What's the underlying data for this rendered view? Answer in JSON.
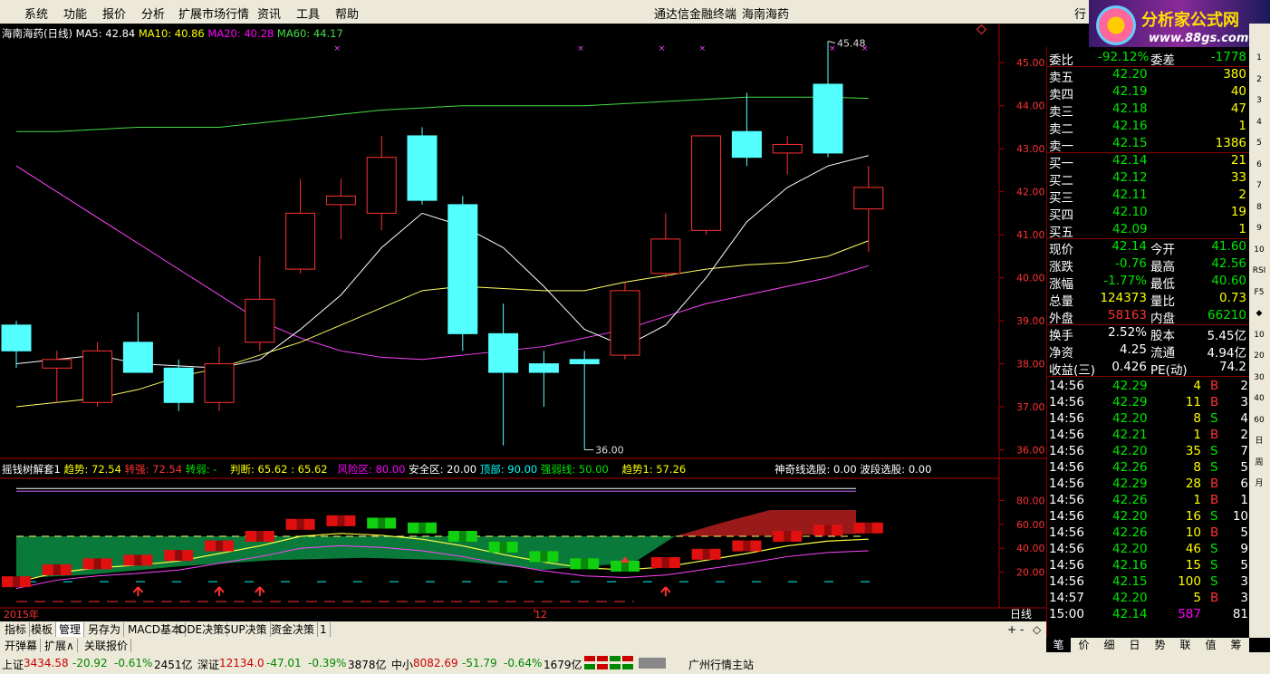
{
  "menubar": {
    "items": [
      "系统",
      "功能",
      "报价",
      "分析",
      "扩展市场行情",
      "资讯",
      "工具",
      "帮助"
    ],
    "app_title": "通达信金融终端",
    "stock_title": "海南海药",
    "right_button": "行"
  },
  "logo": {
    "line1": "分析家公式网",
    "line2": "www.88gs.com"
  },
  "main_legend": {
    "name": "海南海药(日线)",
    "ma5": "MA5: 42.84",
    "ma10": "MA10: 40.86",
    "ma20": "MA20: 40.28",
    "ma60": "MA60: 44.17"
  },
  "price_axis": [
    "45.00",
    "44.00",
    "43.00",
    "42.00",
    "41.00",
    "40.00",
    "39.00",
    "38.00",
    "37.00",
    "36.00"
  ],
  "annotations": {
    "high": "45.48",
    "low": "36.00"
  },
  "indicator_legend": {
    "name": "摇钱树解套1",
    "trend": "趋势: 72.54",
    "strong": "转强: 72.54",
    "weak": "转弱: -",
    "judge": "判断: 65.62 : 65.62",
    "risk": "风险区: 80.00",
    "safe": "安全区: 20.00",
    "top": "顶部: 90.00",
    "line": "强弱线: 50.00",
    "trend1": "趋势1: 57.26",
    "magic": "神奇线选股: 0.00",
    "wave": "波段选股: 0.00"
  },
  "indicator_axis": [
    "80.00",
    "60.00",
    "40.00",
    "20.00"
  ],
  "date_axis": {
    "left": "2015年",
    "mid": "12",
    "period": "日线",
    "ctrl": [
      "+",
      "-",
      "◇"
    ]
  },
  "quote": {
    "wei": {
      "label1": "委比",
      "v1": "-92.12%",
      "label2": "委差",
      "v2": "-1778"
    },
    "sells": [
      {
        "label": "卖五",
        "price": "42.20",
        "vol": "380"
      },
      {
        "label": "卖四",
        "price": "42.19",
        "vol": "40"
      },
      {
        "label": "卖三",
        "price": "42.18",
        "vol": "47"
      },
      {
        "label": "卖二",
        "price": "42.16",
        "vol": "1"
      },
      {
        "label": "卖一",
        "price": "42.15",
        "vol": "1386"
      }
    ],
    "buys": [
      {
        "label": "买一",
        "price": "42.14",
        "vol": "21"
      },
      {
        "label": "买二",
        "price": "42.12",
        "vol": "33"
      },
      {
        "label": "买三",
        "price": "42.11",
        "vol": "2"
      },
      {
        "label": "买四",
        "price": "42.10",
        "vol": "19"
      },
      {
        "label": "买五",
        "price": "42.09",
        "vol": "1"
      }
    ],
    "stats": [
      {
        "l1": "现价",
        "v1": "42.14",
        "c1": "dn",
        "l2": "今开",
        "v2": "41.60",
        "c2": "dn"
      },
      {
        "l1": "涨跌",
        "v1": "-0.76",
        "c1": "dn",
        "l2": "最高",
        "v2": "42.56",
        "c2": "dn"
      },
      {
        "l1": "涨幅",
        "v1": "-1.77%",
        "c1": "dn",
        "l2": "最低",
        "v2": "40.60",
        "c2": "dn"
      },
      {
        "l1": "总量",
        "v1": "124373",
        "c1": "yl",
        "l2": "量比",
        "v2": "0.73",
        "c2": "yl"
      },
      {
        "l1": "外盘",
        "v1": "58163",
        "c1": "up",
        "l2": "内盘",
        "v2": "66210",
        "c2": "dn"
      }
    ],
    "fund": [
      {
        "l1": "换手",
        "v1": "2.52%",
        "l2": "股本",
        "v2": "5.45亿"
      },
      {
        "l1": "净资",
        "v1": "4.25",
        "l2": "流通",
        "v2": "4.94亿"
      },
      {
        "l1": "收益(三)",
        "v1": "0.426",
        "l2": "PE(动)",
        "v2": "74.2"
      }
    ],
    "ticks": [
      {
        "t": "14:56",
        "p": "42.29",
        "v": "4",
        "bs": "B",
        "n": "2"
      },
      {
        "t": "14:56",
        "p": "42.29",
        "v": "11",
        "bs": "B",
        "n": "3"
      },
      {
        "t": "14:56",
        "p": "42.20",
        "v": "8",
        "bs": "S",
        "n": "4"
      },
      {
        "t": "14:56",
        "p": "42.21",
        "v": "1",
        "bs": "B",
        "n": "2"
      },
      {
        "t": "14:56",
        "p": "42.20",
        "v": "35",
        "bs": "S",
        "n": "7"
      },
      {
        "t": "14:56",
        "p": "42.26",
        "v": "8",
        "bs": "S",
        "n": "5"
      },
      {
        "t": "14:56",
        "p": "42.29",
        "v": "28",
        "bs": "B",
        "n": "6"
      },
      {
        "t": "14:56",
        "p": "42.26",
        "v": "1",
        "bs": "B",
        "n": "1"
      },
      {
        "t": "14:56",
        "p": "42.20",
        "v": "16",
        "bs": "S",
        "n": "10"
      },
      {
        "t": "14:56",
        "p": "42.26",
        "v": "10",
        "bs": "B",
        "n": "5"
      },
      {
        "t": "14:56",
        "p": "42.20",
        "v": "46",
        "bs": "S",
        "n": "9"
      },
      {
        "t": "14:56",
        "p": "42.16",
        "v": "15",
        "bs": "S",
        "n": "5"
      },
      {
        "t": "14:56",
        "p": "42.15",
        "v": "100",
        "bs": "S",
        "n": "3"
      },
      {
        "t": "14:57",
        "p": "42.20",
        "v": "5",
        "bs": "B",
        "n": "3"
      },
      {
        "t": "15:00",
        "p": "42.14",
        "v": "587",
        "bs": "",
        "n": "81"
      }
    ]
  },
  "tabs1": [
    "指标",
    "模板",
    "管理",
    "另存为",
    "MACD基本",
    "DDE决策",
    "SUP决策",
    "资金决策",
    "1"
  ],
  "tabs2": [
    "开弹幕",
    "扩展∧",
    "关联报价"
  ],
  "rtabs": [
    "笔",
    "价",
    "细",
    "日",
    "势",
    "联",
    "值",
    "筹"
  ],
  "toolstrip": [
    "1",
    "2",
    "3",
    "4",
    "5",
    "6",
    "7",
    "8",
    "9",
    "10",
    "RSI",
    "F5",
    "◆",
    "10",
    "20",
    "30",
    "40",
    "60",
    "日",
    "周",
    "月"
  ],
  "statusbar": {
    "sh": {
      "label": "上证",
      "idx": "3434.58",
      "chg": "-20.92",
      "pct": "-0.61%",
      "amt": "2451亿"
    },
    "sz": {
      "label": "深证",
      "idx": "12134.0",
      "chg": "-47.01",
      "pct": "-0.39%",
      "amt": "3878亿"
    },
    "zx": {
      "label": "中小",
      "idx": "8082.69",
      "chg": "-51.79",
      "pct": "-0.64%",
      "amt": "1679亿"
    },
    "station": "广州行情主站"
  },
  "colors": {
    "up": "#ff3232",
    "down": "#54ffff",
    "ma5": "#ffffff",
    "ma10": "#ffff66",
    "ma20": "#ff44ff",
    "ma60": "#44dd44"
  },
  "chart_data": {
    "type": "candlestick",
    "ylim": [
      35.8,
      45.7
    ],
    "candles": [
      {
        "o": 38.9,
        "h": 39.0,
        "l": 37.9,
        "c": 38.3
      },
      {
        "o": 37.9,
        "h": 38.3,
        "l": 37.1,
        "c": 38.1
      },
      {
        "o": 37.1,
        "h": 38.5,
        "l": 37.0,
        "c": 38.3
      },
      {
        "o": 38.5,
        "h": 39.2,
        "l": 37.8,
        "c": 37.8
      },
      {
        "o": 37.9,
        "h": 38.1,
        "l": 36.9,
        "c": 37.1
      },
      {
        "o": 37.1,
        "h": 38.4,
        "l": 36.9,
        "c": 38.0
      },
      {
        "o": 38.5,
        "h": 40.5,
        "l": 38.3,
        "c": 39.5
      },
      {
        "o": 40.2,
        "h": 42.3,
        "l": 40.1,
        "c": 41.5
      },
      {
        "o": 41.7,
        "h": 42.3,
        "l": 40.9,
        "c": 41.9
      },
      {
        "o": 41.5,
        "h": 43.3,
        "l": 41.1,
        "c": 42.8
      },
      {
        "o": 43.3,
        "h": 43.5,
        "l": 41.7,
        "c": 41.8
      },
      {
        "o": 41.7,
        "h": 41.9,
        "l": 38.3,
        "c": 38.7
      },
      {
        "o": 38.7,
        "h": 39.4,
        "l": 36.1,
        "c": 37.8
      },
      {
        "o": 38.0,
        "h": 38.3,
        "l": 37.0,
        "c": 37.8
      },
      {
        "o": 38.1,
        "h": 38.3,
        "l": 36.0,
        "c": 38.0
      },
      {
        "o": 38.2,
        "h": 39.9,
        "l": 38.1,
        "c": 39.7
      },
      {
        "o": 40.1,
        "h": 41.5,
        "l": 40.0,
        "c": 40.9
      },
      {
        "o": 41.1,
        "h": 43.3,
        "l": 41.0,
        "c": 43.3
      },
      {
        "o": 43.4,
        "h": 44.3,
        "l": 42.6,
        "c": 42.8
      },
      {
        "o": 42.9,
        "h": 43.3,
        "l": 42.4,
        "c": 43.1
      },
      {
        "o": 44.5,
        "h": 45.5,
        "l": 42.8,
        "c": 42.9
      },
      {
        "o": 41.6,
        "h": 42.6,
        "l": 40.6,
        "c": 42.1
      }
    ],
    "ma5": [
      38.0,
      38.1,
      38.2,
      38.0,
      37.95,
      37.9,
      38.1,
      38.8,
      39.6,
      40.7,
      41.5,
      41.2,
      40.7,
      39.8,
      38.8,
      38.4,
      38.9,
      40.0,
      41.3,
      42.1,
      42.6,
      42.84
    ],
    "ma10": [
      37.0,
      37.1,
      37.2,
      37.4,
      37.7,
      37.9,
      38.2,
      38.5,
      38.9,
      39.3,
      39.7,
      39.8,
      39.75,
      39.7,
      39.7,
      39.9,
      40.05,
      40.2,
      40.3,
      40.35,
      40.5,
      40.86
    ],
    "ma20": [
      42.6,
      42.0,
      41.4,
      40.8,
      40.2,
      39.6,
      39.0,
      38.6,
      38.3,
      38.15,
      38.1,
      38.2,
      38.3,
      38.4,
      38.6,
      38.8,
      39.1,
      39.4,
      39.6,
      39.8,
      40.0,
      40.28
    ],
    "ma60": [
      43.4,
      43.4,
      43.45,
      43.5,
      43.5,
      43.5,
      43.6,
      43.7,
      43.8,
      43.9,
      43.95,
      44.0,
      44.0,
      44.0,
      44.0,
      44.05,
      44.1,
      44.15,
      44.2,
      44.2,
      44.2,
      44.17
    ],
    "indicator": {
      "ylim": [
        0,
        100
      ],
      "blocks": [
        12,
        22,
        27,
        30,
        34,
        42,
        50,
        60,
        63,
        61,
        57,
        50,
        41,
        33,
        27,
        25,
        28,
        35,
        42,
        50,
        55,
        57
      ]
    }
  }
}
